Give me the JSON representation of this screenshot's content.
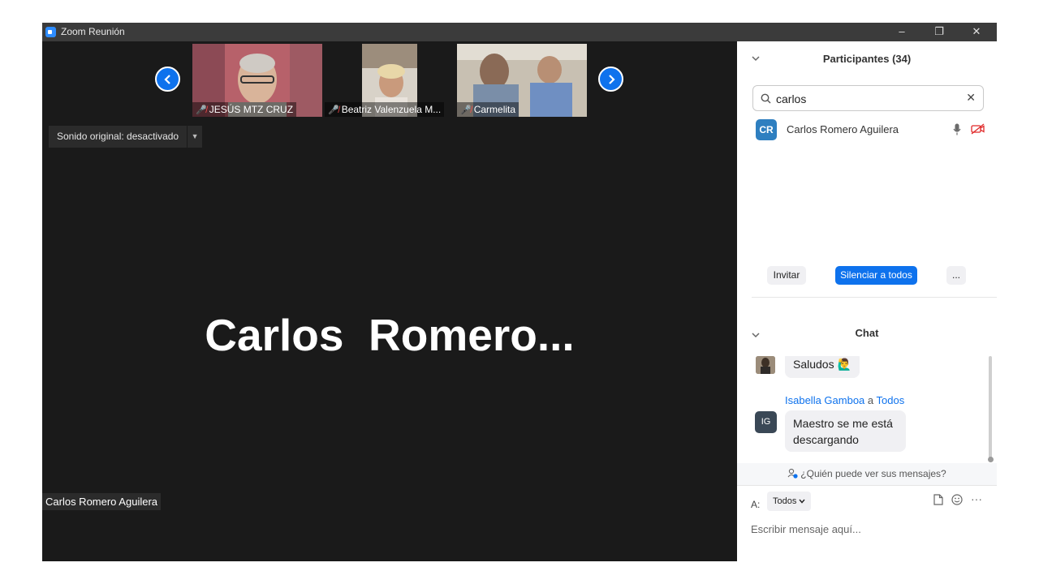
{
  "window": {
    "title": "Zoom Reunión",
    "controls": {
      "minimize": "–",
      "maximize": "❐",
      "close": "✕"
    }
  },
  "thumbnails": [
    {
      "name": "JESÚS MTZ CRUZ",
      "muted": true
    },
    {
      "name": "Beatriz Valenzuela M...",
      "muted": true
    },
    {
      "name": "Carmelita",
      "muted": true
    }
  ],
  "audio": {
    "original_sound_label": "Sonido original: desactivado"
  },
  "active_speaker": {
    "display_name": "Carlos  Romero...",
    "name_tag": "Carlos Romero Aguilera"
  },
  "participants": {
    "title": "Participantes (34)",
    "search": {
      "value": "carlos"
    },
    "list": [
      {
        "initials": "CR",
        "name": "Carlos Romero Aguilera",
        "avatar_color": "#2e7fc0"
      }
    ],
    "buttons": {
      "invite": "Invitar",
      "mute_all": "Silenciar a todos",
      "more": "..."
    }
  },
  "chat": {
    "title": "Chat",
    "messages": [
      {
        "text": "Saludos",
        "emoji": "🙋‍♂️"
      },
      {
        "sender": "Isabella Gamboa",
        "to_word": "a",
        "recipient": "Todos",
        "initials": "IG",
        "text": "Maestro se me está descargando"
      }
    ],
    "privacy_link": "¿Quién puede ver sus mensajes?",
    "to_label": "A:",
    "to_value": "Todos",
    "input_placeholder": "Escribir mensaje aquí...",
    "more": "···"
  },
  "colors": {
    "accent": "#0e72ed",
    "video_bg": "#1a1a1a",
    "muted_red": "#ff4d4d"
  }
}
